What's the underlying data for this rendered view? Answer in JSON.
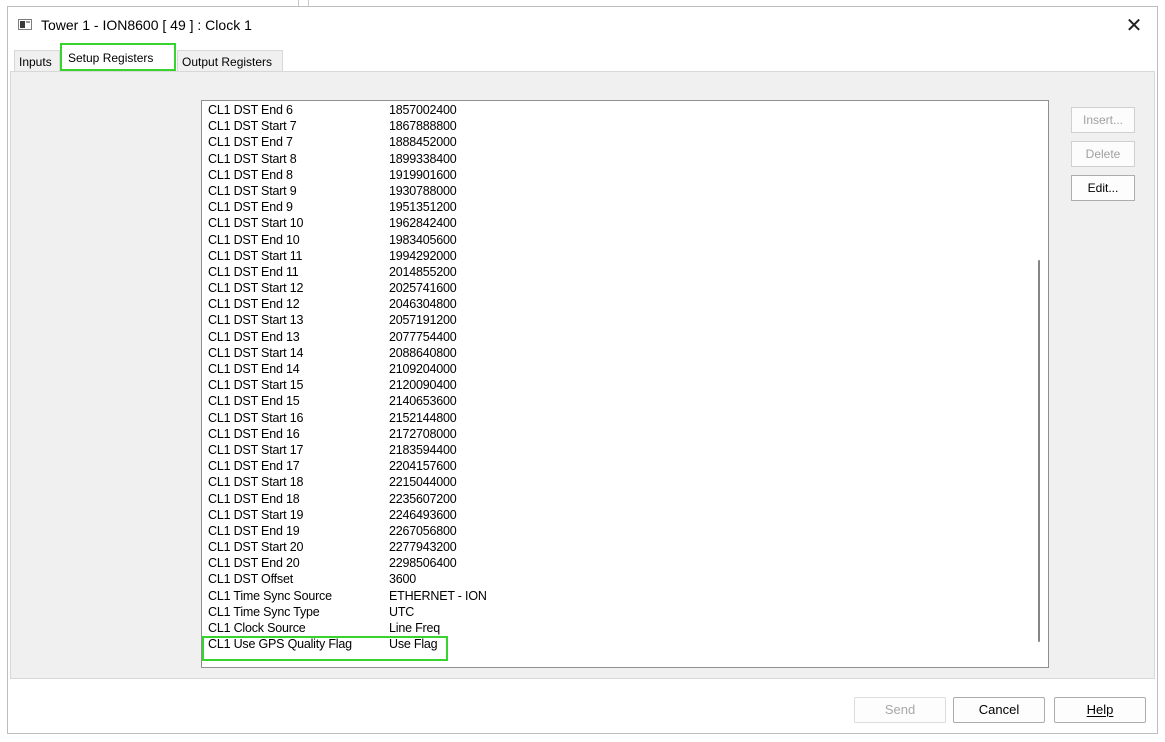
{
  "window": {
    "title": "Tower 1 - ION8600 [ 49 ] : Clock 1",
    "close_glyph": "✕",
    "app_icon": "window-icon",
    "close_icon": "close-icon"
  },
  "tabs": [
    {
      "label": "Inputs"
    },
    {
      "label": "Setup Registers",
      "selected": true
    },
    {
      "label": "Output Registers"
    }
  ],
  "registers": [
    {
      "name": "CL1 DST End 6",
      "value": "1857002400"
    },
    {
      "name": "CL1 DST Start 7",
      "value": "1867888800"
    },
    {
      "name": "CL1 DST End 7",
      "value": "1888452000"
    },
    {
      "name": "CL1 DST Start 8",
      "value": "1899338400"
    },
    {
      "name": "CL1 DST End 8",
      "value": "1919901600"
    },
    {
      "name": "CL1 DST Start 9",
      "value": "1930788000"
    },
    {
      "name": "CL1 DST End 9",
      "value": "1951351200"
    },
    {
      "name": "CL1 DST Start 10",
      "value": "1962842400"
    },
    {
      "name": "CL1 DST End 10",
      "value": "1983405600"
    },
    {
      "name": "CL1 DST Start 11",
      "value": "1994292000"
    },
    {
      "name": "CL1 DST End 11",
      "value": "2014855200"
    },
    {
      "name": "CL1 DST Start 12",
      "value": "2025741600"
    },
    {
      "name": "CL1 DST End 12",
      "value": "2046304800"
    },
    {
      "name": "CL1 DST Start 13",
      "value": "2057191200"
    },
    {
      "name": "CL1 DST End 13",
      "value": "2077754400"
    },
    {
      "name": "CL1 DST Start 14",
      "value": "2088640800"
    },
    {
      "name": "CL1 DST End 14",
      "value": "2109204000"
    },
    {
      "name": "CL1 DST Start 15",
      "value": "2120090400"
    },
    {
      "name": "CL1 DST End 15",
      "value": "2140653600"
    },
    {
      "name": "CL1 DST Start 16",
      "value": "2152144800"
    },
    {
      "name": "CL1 DST End 16",
      "value": "2172708000"
    },
    {
      "name": "CL1 DST Start 17",
      "value": "2183594400"
    },
    {
      "name": "CL1 DST End 17",
      "value": "2204157600"
    },
    {
      "name": "CL1 DST Start 18",
      "value": "2215044000"
    },
    {
      "name": "CL1 DST End 18",
      "value": "2235607200"
    },
    {
      "name": "CL1 DST Start 19",
      "value": "2246493600"
    },
    {
      "name": "CL1 DST End 19",
      "value": "2267056800"
    },
    {
      "name": "CL1 DST Start 20",
      "value": "2277943200"
    },
    {
      "name": "CL1 DST End 20",
      "value": "2298506400"
    },
    {
      "name": "CL1 DST Offset",
      "value": "3600"
    },
    {
      "name": "CL1 Time Sync Source",
      "value": "ETHERNET - ION"
    },
    {
      "name": "CL1 Time Sync Type",
      "value": "UTC"
    },
    {
      "name": "CL1 Clock Source",
      "value": "Line Freq"
    },
    {
      "name": "CL1 Use GPS Quality Flag",
      "value": "Use Flag"
    }
  ],
  "side_buttons": {
    "insert": "Insert...",
    "delete": "Delete",
    "edit": "Edit..."
  },
  "bottom_buttons": {
    "send": "Send",
    "cancel": "Cancel",
    "help": "Help"
  },
  "colors": {
    "highlight": "#37d42f"
  }
}
